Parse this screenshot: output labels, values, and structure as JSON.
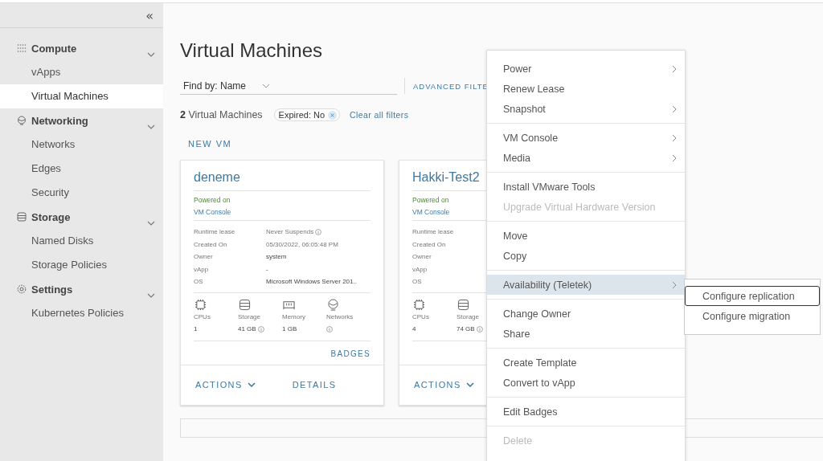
{
  "sidebar": {
    "collapse_glyph": "«",
    "sections": [
      {
        "label": "Compute",
        "expanded": true,
        "items": [
          {
            "label": "vApps",
            "selected": false
          },
          {
            "label": "Virtual Machines",
            "selected": true
          }
        ]
      },
      {
        "label": "Networking",
        "expanded": true,
        "items": [
          {
            "label": "Networks",
            "selected": false
          },
          {
            "label": "Edges",
            "selected": false
          },
          {
            "label": "Security",
            "selected": false
          }
        ]
      },
      {
        "label": "Storage",
        "expanded": true,
        "items": [
          {
            "label": "Named Disks",
            "selected": false
          },
          {
            "label": "Storage Policies",
            "selected": false
          }
        ]
      },
      {
        "label": "Settings",
        "expanded": true,
        "items": [
          {
            "label": "Kubernetes Policies",
            "selected": false
          }
        ]
      }
    ]
  },
  "page": {
    "title": "Virtual Machines",
    "find_by": {
      "label": "Find by:",
      "value": "Name"
    },
    "advanced_filter": "ADVANCED FILTE",
    "count": "2",
    "count_label": "Virtual Machines",
    "filter_chip": "Expired: No",
    "clear_filters": "Clear all filters",
    "new_vm": "NEW VM"
  },
  "cards": [
    {
      "name": "deneme",
      "status": "Powered on",
      "console": "VM Console",
      "details": [
        {
          "label": "Runtime lease",
          "value": "Never Suspends",
          "info": true
        },
        {
          "label": "Created On",
          "value": "05/30/2022, 06:05:48 PM",
          "info": false
        },
        {
          "label": "Owner",
          "value": "system",
          "info": false
        },
        {
          "label": "vApp",
          "value": "-",
          "info": false
        },
        {
          "label": "OS",
          "value": "Microsoft Windows Server 201..",
          "info": false
        }
      ],
      "stats": [
        {
          "kind": "cpu",
          "label": "CPUs",
          "value": "1",
          "info": false
        },
        {
          "kind": "storage",
          "label": "Storage",
          "value": "41 GB",
          "info": true
        },
        {
          "kind": "memory",
          "label": "Memory",
          "value": "1 GB",
          "info": false
        },
        {
          "kind": "network",
          "label": "Networks",
          "info": true
        }
      ],
      "badges": "BADGES",
      "actions": "ACTIONS",
      "details_link": "DETAILS"
    },
    {
      "name": "Hakki-Test2",
      "status": "Powered on",
      "console": "VM Console",
      "details": [
        {
          "label": "Runtime lease"
        },
        {
          "label": "Created On"
        },
        {
          "label": "Owner"
        },
        {
          "label": "vApp"
        },
        {
          "label": "OS"
        }
      ],
      "stats": [
        {
          "kind": "cpu",
          "label": "CPUs",
          "value": "4",
          "info": false
        },
        {
          "kind": "storage",
          "label": "Storage",
          "value": "74 GB",
          "info": true
        }
      ],
      "actions": "ACTIONS"
    }
  ],
  "context_menu": {
    "groups": [
      [
        {
          "label": "Power",
          "submenu": true,
          "disabled": false,
          "selected": false
        },
        {
          "label": "Renew Lease",
          "submenu": false,
          "disabled": false,
          "selected": false
        },
        {
          "label": "Snapshot",
          "submenu": true,
          "disabled": false,
          "selected": false
        }
      ],
      [
        {
          "label": "VM Console",
          "submenu": true,
          "disabled": false,
          "selected": false
        },
        {
          "label": "Media",
          "submenu": true,
          "disabled": false,
          "selected": false
        }
      ],
      [
        {
          "label": "Install VMware Tools",
          "submenu": false,
          "disabled": false,
          "selected": false
        },
        {
          "label": "Upgrade Virtual Hardware Version",
          "submenu": false,
          "disabled": true,
          "selected": false
        }
      ],
      [
        {
          "label": "Move",
          "submenu": false,
          "disabled": false,
          "selected": false
        },
        {
          "label": "Copy",
          "submenu": false,
          "disabled": false,
          "selected": false
        }
      ],
      [
        {
          "label": "Availability (Teletek)",
          "submenu": true,
          "disabled": false,
          "selected": true
        }
      ],
      [
        {
          "label": "Change Owner",
          "submenu": false,
          "disabled": false,
          "selected": false
        },
        {
          "label": "Share",
          "submenu": false,
          "disabled": false,
          "selected": false
        }
      ],
      [
        {
          "label": "Create Template",
          "submenu": false,
          "disabled": false,
          "selected": false
        },
        {
          "label": "Convert to vApp",
          "submenu": false,
          "disabled": false,
          "selected": false
        }
      ],
      [
        {
          "label": "Edit Badges",
          "submenu": false,
          "disabled": false,
          "selected": false
        }
      ],
      [
        {
          "label": "Delete",
          "submenu": false,
          "disabled": true,
          "selected": false
        }
      ]
    ]
  },
  "submenu": {
    "items": [
      {
        "label": "Configure replication",
        "focused": true
      },
      {
        "label": "Configure migration",
        "focused": false
      }
    ]
  }
}
